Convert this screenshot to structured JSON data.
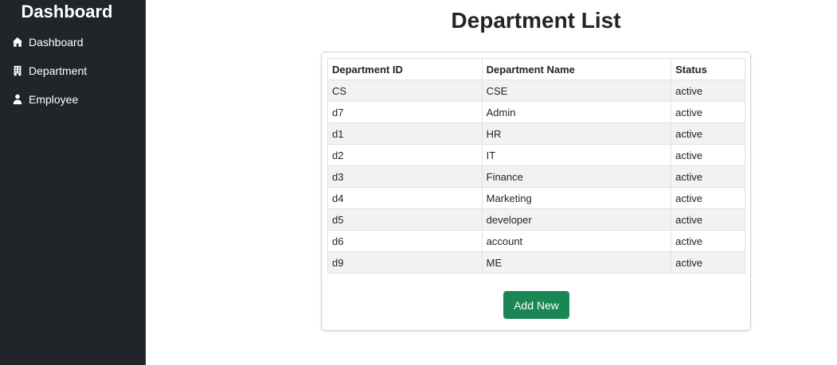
{
  "sidebar": {
    "title": "Dashboard",
    "items": [
      {
        "label": "Dashboard",
        "icon": "home-icon"
      },
      {
        "label": "Department",
        "icon": "building-icon"
      },
      {
        "label": "Employee",
        "icon": "user-tie-icon"
      }
    ]
  },
  "main": {
    "title": "Department List",
    "table": {
      "headers": [
        "Department ID",
        "Department Name",
        "Status"
      ],
      "rows": [
        [
          "CS",
          "CSE",
          "active"
        ],
        [
          "d7",
          "Admin",
          "active"
        ],
        [
          "d1",
          "HR",
          "active"
        ],
        [
          "d2",
          "IT",
          "active"
        ],
        [
          "d3",
          "Finance",
          "active"
        ],
        [
          "d4",
          "Marketing",
          "active"
        ],
        [
          "d5",
          "developer",
          "active"
        ],
        [
          "d6",
          "account",
          "active"
        ],
        [
          "d9",
          "ME",
          "active"
        ]
      ]
    },
    "add_button_label": "Add New"
  },
  "colors": {
    "sidebar_bg": "#212529",
    "button_bg": "#198754",
    "stripe": "#f2f2f2"
  }
}
